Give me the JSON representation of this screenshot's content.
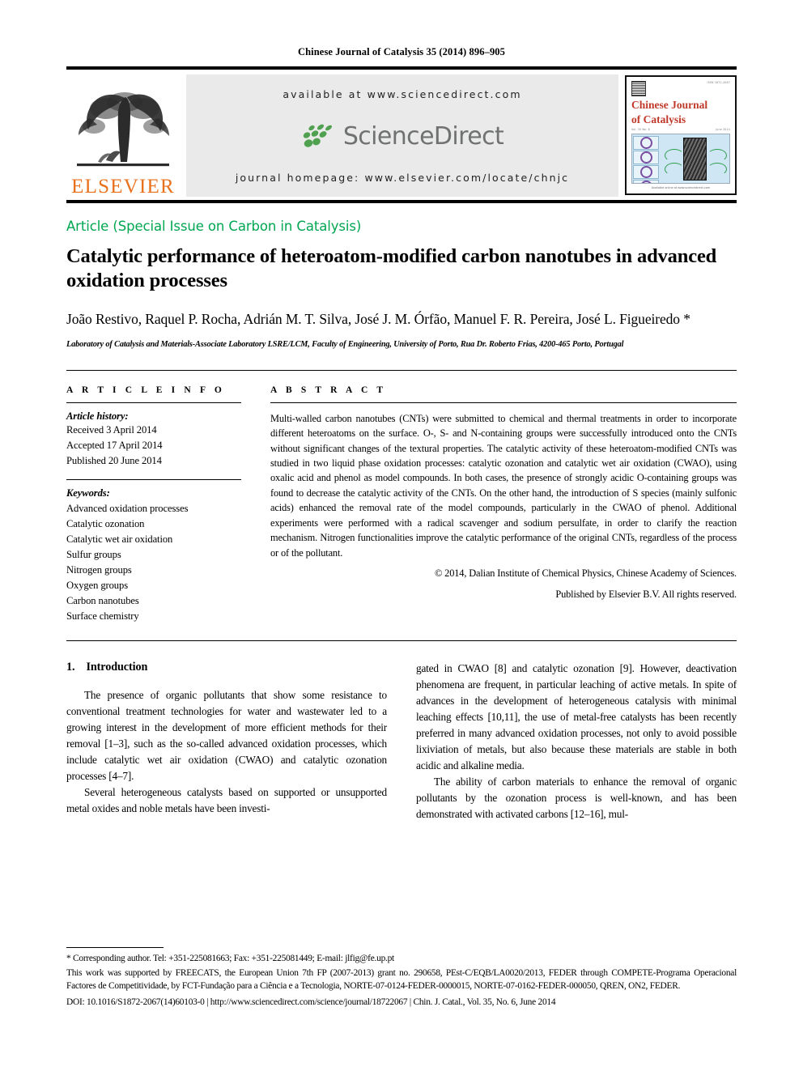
{
  "running_head": "Chinese Journal of Catalysis 35 (2014) 896–905",
  "masthead": {
    "publisher_name": "ELSEVIER",
    "available_at": "available at www.sciencedirect.com",
    "sciencedirect_wordmark": "ScienceDirect",
    "journal_homepage": "journal homepage: www.elsevier.com/locate/chnjc",
    "cover": {
      "title_line1": "Chinese Journal",
      "title_line2": "of Catalysis",
      "issn_note": "ISSN 1872-2067",
      "volume_note": "Vol. 35  No. 6",
      "date_note": "June 2014",
      "credit": "Available online at www.sciencedirect.com"
    }
  },
  "article_type": "Article (Special Issue on Carbon in Catalysis)",
  "title": "Catalytic performance of heteroatom-modified carbon nanotubes in advanced oxidation processes",
  "authors": "João Restivo, Raquel P. Rocha, Adrián M. T. Silva, José J. M. Órfão, Manuel F. R. Pereira, José L. Figueiredo *",
  "affiliation": "Laboratory of Catalysis and Materials-Associate Laboratory LSRE/LCM, Faculty of Engineering, University of Porto, Rua Dr. Roberto Frias, 4200-465 Porto, Portugal",
  "article_info": {
    "heading": "A R T I C L E   I N F O",
    "history_label": "Article history:",
    "history": [
      "Received 3 April 2014",
      "Accepted 17 April 2014",
      "Published 20 June 2014"
    ],
    "keywords_label": "Keywords:",
    "keywords": [
      "Advanced oxidation processes",
      "Catalytic ozonation",
      "Catalytic wet air oxidation",
      "Sulfur groups",
      "Nitrogen groups",
      "Oxygen groups",
      "Carbon nanotubes",
      "Surface chemistry"
    ]
  },
  "abstract": {
    "heading": "A B S T R A C T",
    "body": "Multi-walled carbon nanotubes (CNTs) were submitted to chemical and thermal treatments in order to incorporate different heteroatoms on the surface. O-, S- and N-containing groups were successfully introduced onto the CNTs without significant changes of the textural properties. The catalytic activity of these heteroatom-modified CNTs was studied in two liquid phase oxidation processes: catalytic ozonation and catalytic wet air oxidation (CWAO), using oxalic acid and phenol as model compounds. In both cases, the presence of strongly acidic O-containing groups was found to decrease the catalytic activity of the CNTs. On the other hand, the introduction of S species (mainly sulfonic acids) enhanced the removal rate of the model compounds, particularly in the CWAO of phenol. Additional experiments were performed with a radical scavenger and sodium persulfate, in order to clarify the reaction mechanism. Nitrogen functionalities improve the catalytic performance of the original CNTs, regardless of the process or of the pollutant.",
    "copyright_line1": "© 2014, Dalian Institute of Chemical Physics, Chinese Academy of Sciences.",
    "copyright_line2": "Published by Elsevier B.V. All rights reserved."
  },
  "introduction": {
    "number": "1.",
    "heading": "Introduction",
    "left_paragraphs": [
      "The presence of organic pollutants that show some resistance to conventional treatment technologies for water and wastewater led to a growing interest in the development of more efficient methods for their removal [1–3], such as the so-called advanced oxidation processes, which include catalytic wet air oxidation (CWAO) and catalytic ozonation processes [4–7].",
      "Several heterogeneous catalysts based on supported or unsupported metal oxides and noble metals have been investi-"
    ],
    "right_paragraphs": [
      "gated in CWAO [8] and catalytic ozonation [9]. However, deactivation phenomena are frequent, in particular leaching of active metals. In spite of advances in the development of heterogeneous catalysis with minimal leaching effects [10,11], the use of metal-free catalysts has been recently preferred in many advanced oxidation processes, not only to avoid possible lixiviation of metals, but also because these materials are stable in both acidic and alkaline media.",
      "The ability of carbon materials to enhance the removal of organic pollutants by the ozonation process is well-known, and has been demonstrated with activated carbons [12–16], mul-"
    ]
  },
  "footnotes": {
    "corresponding": "* Corresponding author. Tel: +351-225081663; Fax: +351-225081449; E-mail: jlfig@fe.up.pt",
    "funding": "This work was supported by FREECATS, the European Union 7th FP (2007-2013) grant no. 290658, PEst-C/EQB/LA0020/2013, FEDER through COMPETE-Programa Operacional Factores de Competitividade, by FCT-Fundação para a Ciência e a Tecnologia, NORTE-07-0124-FEDER-0000015, NORTE-07-0162-FEDER-000050, QREN, ON2, FEDER.",
    "doi_line": "DOI: 10.1016/S1872-2067(14)60103-0 | http://www.sciencedirect.com/science/journal/18722067 | Chin. J. Catal., Vol. 35, No. 6, June 2014"
  },
  "colors": {
    "elsevier_orange": "#E9711C",
    "article_type_green": "#00A651",
    "sciencedirect_gray": "#6F7271",
    "sciencedirect_green": "#4FA14F",
    "cover_red": "#C0392B",
    "panel_gray": "#EAEAEA"
  }
}
